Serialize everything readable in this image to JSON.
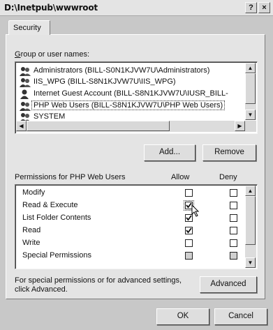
{
  "window": {
    "title": "D:\\Inetpub\\wwwroot",
    "help_glyph": "?",
    "close_glyph": "×"
  },
  "tabs": [
    {
      "label": "Security",
      "active": true
    }
  ],
  "groups": {
    "label": "Group or user names:",
    "items": [
      {
        "label": "Administrators (BILL-S0N1KJVW7U\\Administrators)",
        "icon": "users-group-icon"
      },
      {
        "label": "IIS_WPG (BILL-S8N1KJVW7U\\IIS_WPG)",
        "icon": "users-group-icon"
      },
      {
        "label": "Internet Guest Account (BILL-S8N1KJVW7U\\IUSR_BILL-",
        "icon": "user-icon"
      },
      {
        "label": "PHP Web Users (BILL-S8N1KJVW7U\\PHP Web Users)",
        "icon": "users-group-icon",
        "selected": true
      },
      {
        "label": "SYSTEM",
        "icon": "users-group-icon"
      }
    ]
  },
  "buttons": {
    "add": "Add...",
    "remove": "Remove",
    "advanced": "Advanced",
    "ok": "OK",
    "cancel": "Cancel"
  },
  "permissions": {
    "label": "Permissions for PHP Web Users",
    "allow_header": "Allow",
    "deny_header": "Deny",
    "items": [
      {
        "name": "Modify",
        "allow": false,
        "deny": false
      },
      {
        "name": "Read & Execute",
        "allow": true,
        "deny": false,
        "focused": true
      },
      {
        "name": "List Folder Contents",
        "allow": true,
        "deny": false
      },
      {
        "name": "Read",
        "allow": true,
        "deny": false
      },
      {
        "name": "Write",
        "allow": false,
        "deny": false
      },
      {
        "name": "Special Permissions",
        "allow": false,
        "deny": false,
        "disabled": true
      }
    ]
  },
  "advanced_note": "For special permissions or for advanced settings, click Advanced."
}
